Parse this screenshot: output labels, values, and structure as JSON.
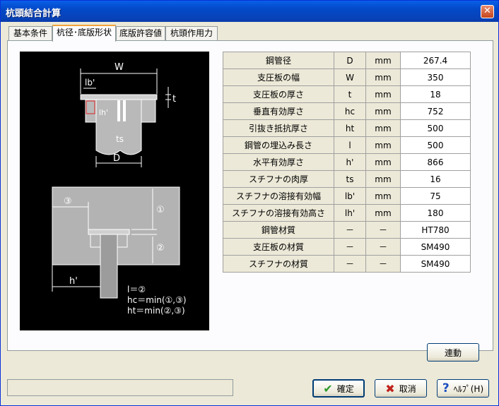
{
  "window": {
    "title": "杭頭結合計算",
    "close_glyph": "✕"
  },
  "tabs": [
    {
      "label": "基本条件"
    },
    {
      "label": "杭径･底版形状"
    },
    {
      "label": "底版許容値"
    },
    {
      "label": "杭頭作用力"
    }
  ],
  "figure": {
    "labels": {
      "W": "W",
      "lb": "lb'",
      "t": "t",
      "lh": "lh'",
      "ts": "ts",
      "D": "D",
      "c1": "①",
      "c2": "②",
      "c3": "③",
      "hprime": "h'",
      "f1": "l＝②",
      "f2": "hc＝min(①,③)",
      "f3": "ht＝min(②,③)"
    }
  },
  "table": {
    "rows": [
      {
        "label": "鋼管径",
        "symbol": "D",
        "unit": "mm",
        "value": "267.4"
      },
      {
        "label": "支圧板の幅",
        "symbol": "W",
        "unit": "mm",
        "value": "350"
      },
      {
        "label": "支圧板の厚さ",
        "symbol": "t",
        "unit": "mm",
        "value": "18"
      },
      {
        "label": "垂直有効厚さ",
        "symbol": "hc",
        "unit": "mm",
        "value": "752"
      },
      {
        "label": "引抜き抵抗厚さ",
        "symbol": "ht",
        "unit": "mm",
        "value": "500"
      },
      {
        "label": "鋼管の埋込み長さ",
        "symbol": "l",
        "unit": "mm",
        "value": "500"
      },
      {
        "label": "水平有効厚さ",
        "symbol": "h'",
        "unit": "mm",
        "value": "866"
      },
      {
        "label": "スチフナの肉厚",
        "symbol": "ts",
        "unit": "mm",
        "value": "16"
      },
      {
        "label": "スチフナの溶接有効幅",
        "symbol": "lb'",
        "unit": "mm",
        "value": "75"
      },
      {
        "label": "スチフナの溶接有効高さ",
        "symbol": "lh'",
        "unit": "mm",
        "value": "180"
      },
      {
        "label": "鋼管材質",
        "symbol": "－",
        "unit": "－",
        "value": "HT780"
      },
      {
        "label": "支圧板の材質",
        "symbol": "－",
        "unit": "－",
        "value": "SM490"
      },
      {
        "label": "スチフナの材質",
        "symbol": "－",
        "unit": "－",
        "value": "SM490"
      }
    ]
  },
  "buttons": {
    "link": "連動",
    "ok": "確定",
    "cancel": "取消",
    "help": "ﾍﾙﾌﾟ(H)"
  },
  "status": {
    "text": ""
  }
}
